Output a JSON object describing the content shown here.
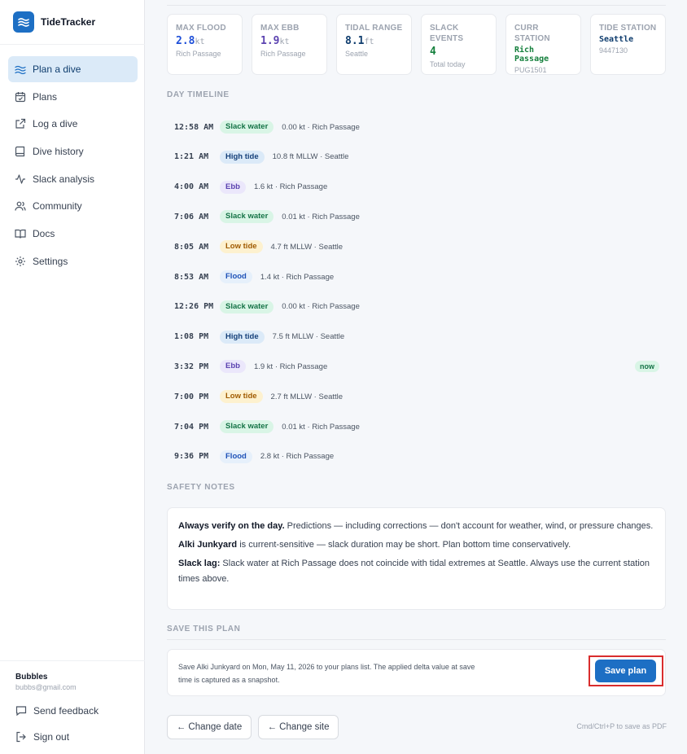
{
  "app": {
    "name": "TideTracker"
  },
  "nav": [
    {
      "label": "Plan a dive",
      "icon": "waves-icon",
      "active": true
    },
    {
      "label": "Plans",
      "icon": "calendar-check-icon"
    },
    {
      "label": "Log a dive",
      "icon": "external-link-icon"
    },
    {
      "label": "Dive history",
      "icon": "book-icon"
    },
    {
      "label": "Slack analysis",
      "icon": "activity-icon"
    },
    {
      "label": "Community",
      "icon": "users-icon"
    },
    {
      "label": "Docs",
      "icon": "book-open-icon"
    },
    {
      "label": "Settings",
      "icon": "gear-icon"
    }
  ],
  "user": {
    "name": "Bubbles",
    "email": "bubbs@gmail.com"
  },
  "footer_links": {
    "feedback": "Send feedback",
    "signout": "Sign out"
  },
  "stats": [
    {
      "label": "MAX FLOOD",
      "value": "2.8",
      "unit": "kt",
      "sub": "Rich Passage",
      "color": "#1d4ed8"
    },
    {
      "label": "MAX EBB",
      "value": "1.9",
      "unit": "kt",
      "sub": "Rich Passage",
      "color": "#5b42b0"
    },
    {
      "label": "TIDAL RANGE",
      "value": "8.1",
      "unit": "ft",
      "sub": "Seattle",
      "color": "#0f3d6e"
    },
    {
      "label": "SLACK EVENTS",
      "value": "4",
      "unit": "",
      "sub": "Total today",
      "color": "#15803d"
    },
    {
      "label": "CURR STATION",
      "value": "Rich Passage",
      "unit": "",
      "sub": "PUG1501",
      "color": "#15803d"
    },
    {
      "label": "TIDE STATION",
      "value": "Seattle",
      "unit": "",
      "sub": "9447130",
      "color": "#0f3d6e"
    }
  ],
  "timeline_title": "DAY TIMELINE",
  "timeline": [
    {
      "time": "12:58 AM",
      "tag": "Slack water",
      "kind": "slack",
      "detail": "0.00 kt · Rich Passage"
    },
    {
      "time": "1:21 AM",
      "tag": "High tide",
      "kind": "high",
      "detail": "10.8 ft MLLW · Seattle"
    },
    {
      "time": "4:00 AM",
      "tag": "Ebb",
      "kind": "ebb",
      "detail": "1.6 kt · Rich Passage"
    },
    {
      "time": "7:06 AM",
      "tag": "Slack water",
      "kind": "slack",
      "detail": "0.01 kt · Rich Passage"
    },
    {
      "time": "8:05 AM",
      "tag": "Low tide",
      "kind": "low",
      "detail": "4.7 ft MLLW · Seattle"
    },
    {
      "time": "8:53 AM",
      "tag": "Flood",
      "kind": "flood",
      "detail": "1.4 kt · Rich Passage"
    },
    {
      "time": "12:26 PM",
      "tag": "Slack water",
      "kind": "slack",
      "detail": "0.00 kt · Rich Passage"
    },
    {
      "time": "1:08 PM",
      "tag": "High tide",
      "kind": "high",
      "detail": "7.5 ft MLLW · Seattle"
    },
    {
      "time": "3:32 PM",
      "tag": "Ebb",
      "kind": "ebb",
      "detail": "1.9 kt · Rich Passage",
      "badge": "now"
    },
    {
      "time": "7:00 PM",
      "tag": "Low tide",
      "kind": "low",
      "detail": "2.7 ft MLLW · Seattle"
    },
    {
      "time": "7:04 PM",
      "tag": "Slack water",
      "kind": "slack",
      "detail": "0.01 kt · Rich Passage"
    },
    {
      "time": "9:36 PM",
      "tag": "Flood",
      "kind": "flood",
      "detail": "2.8 kt · Rich Passage"
    }
  ],
  "safety": {
    "title": "SAFETY NOTES",
    "notes": [
      {
        "bold": "Always verify on the day.",
        "text": " Predictions — including corrections — don't account for weather, wind, or pressure changes."
      },
      {
        "bold": "Alki Junkyard",
        "text": " is current-sensitive — slack duration may be short. Plan bottom time conservatively."
      },
      {
        "bold": "Slack lag:",
        "text": " Slack water at Rich Passage does not coincide with tidal extremes at Seattle. Always use the current station times above."
      }
    ]
  },
  "save": {
    "title": "SAVE THIS PLAN",
    "text": "Save Alki Junkyard on Mon, May 11, 2026 to your plans list. The applied delta value at save time is captured as a snapshot.",
    "button": "Save plan"
  },
  "actions": {
    "change_date": "← Change date",
    "change_site": "← Change site",
    "pdf_hint": "Cmd/Ctrl+P to save as PDF"
  }
}
